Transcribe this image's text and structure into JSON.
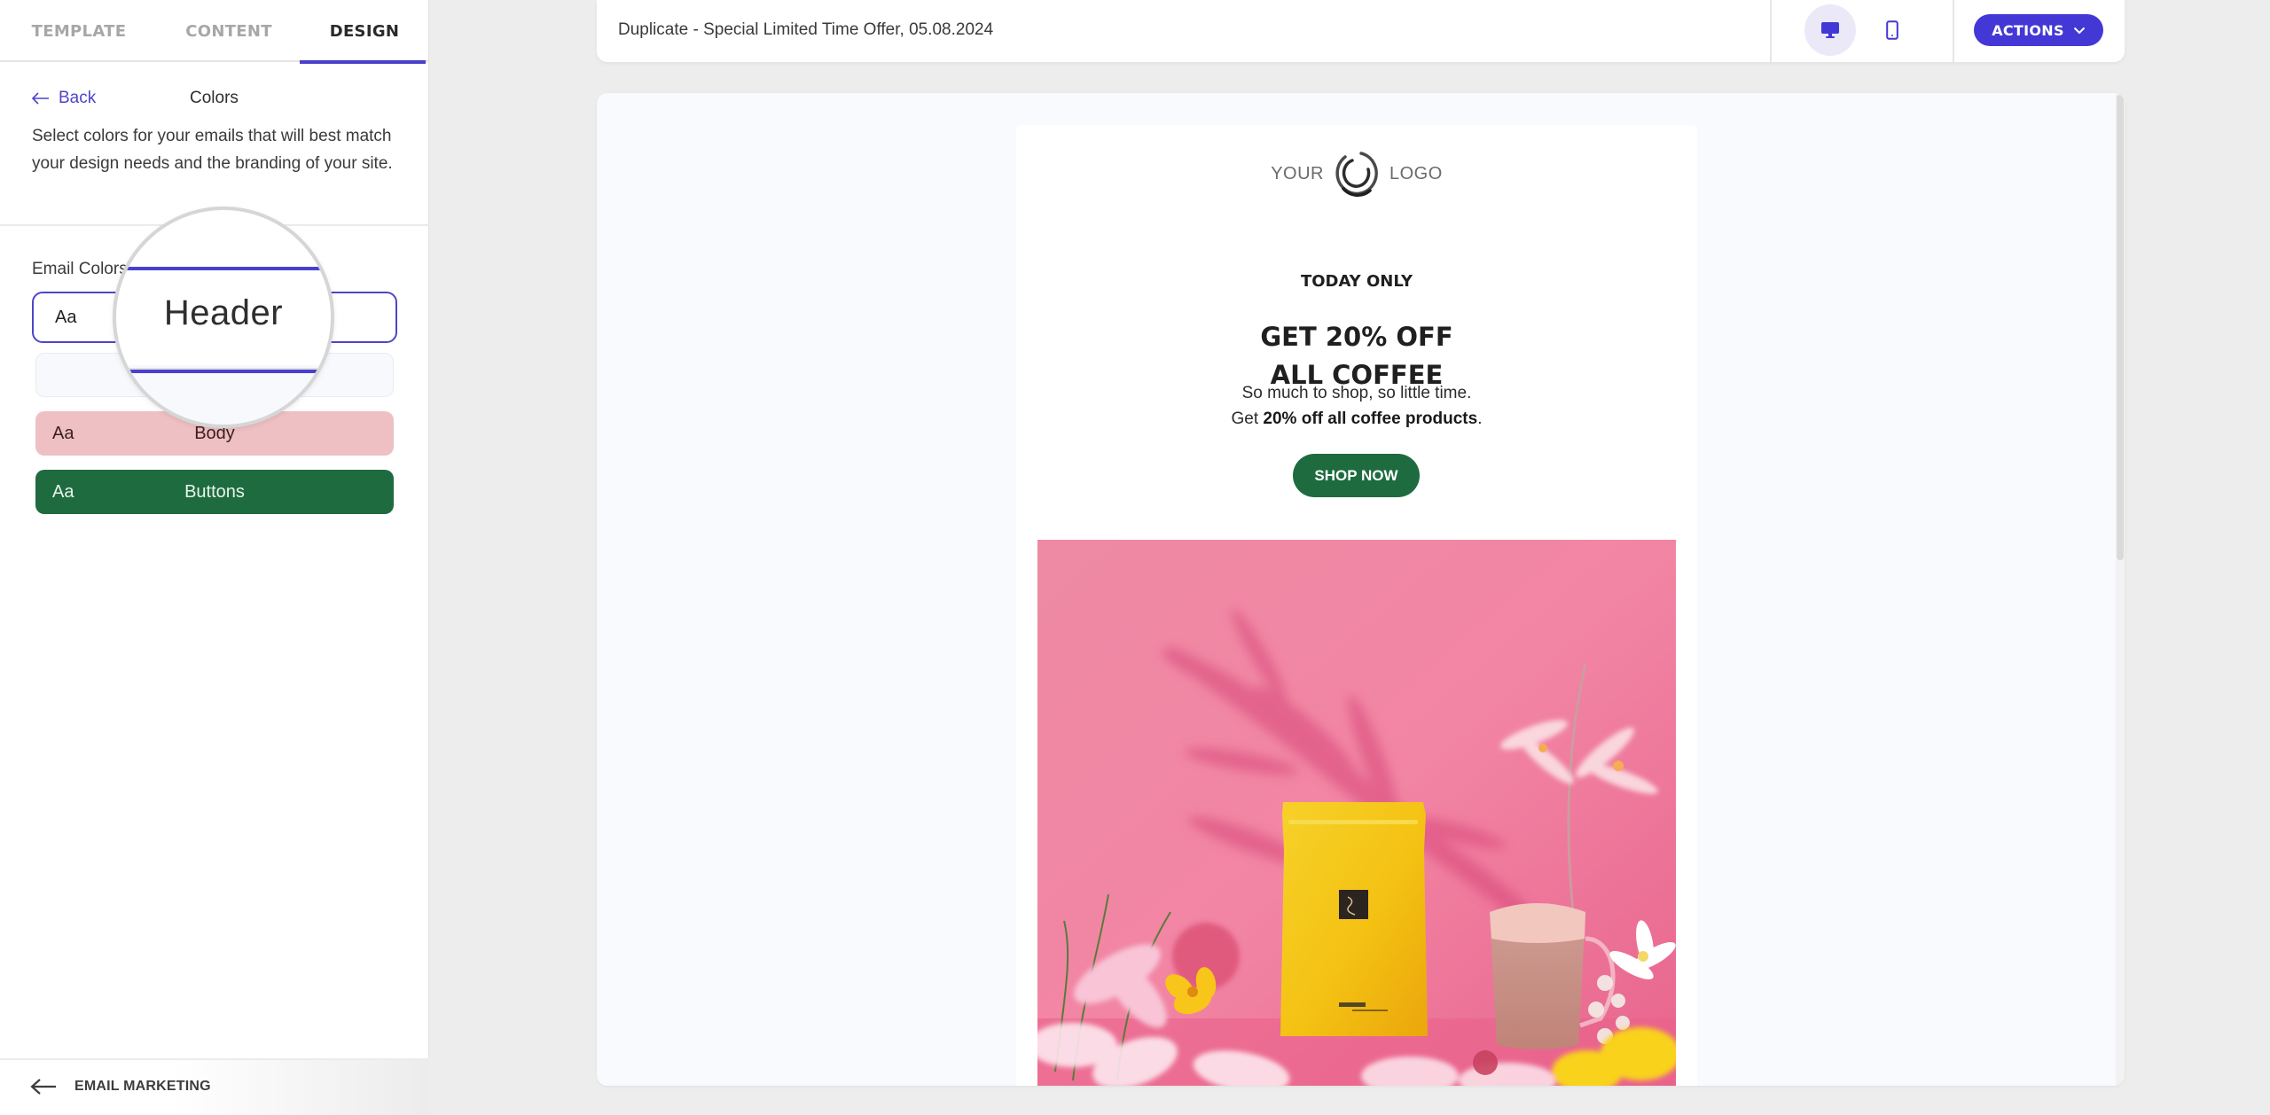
{
  "sidebar": {
    "tabs": [
      {
        "label": "TEMPLATE",
        "active": false
      },
      {
        "label": "CONTENT",
        "active": false
      },
      {
        "label": "DESIGN",
        "active": true
      }
    ],
    "back_label": "Back",
    "panel_title": "Colors",
    "description": "Select colors for your emails that will best match your design needs and the branding of your site.",
    "email_colors_label": "Email Colors",
    "color_rows": [
      {
        "sample": "Aa",
        "label": "Header",
        "bg": "#ffffff",
        "fg": "#222222",
        "selected": true
      },
      {
        "sample": "",
        "label": "",
        "bg": "#f7f9fd",
        "fg": "#555555",
        "selected": false
      },
      {
        "sample": "Aa",
        "label": "Body",
        "bg": "#eec0c3",
        "fg": "#3b1f20",
        "selected": false
      },
      {
        "sample": "Aa",
        "label": "Buttons",
        "bg": "#1e6b3f",
        "fg": "#e9f4ec",
        "selected": false
      }
    ],
    "magnifier_text": "Header",
    "footer_link": "EMAIL MARKETING"
  },
  "topbar": {
    "document_title": "Duplicate - Special Limited Time Offer, 05.08.2024",
    "devices": [
      {
        "name": "desktop",
        "icon": "desktop-icon",
        "active": true
      },
      {
        "name": "mobile",
        "icon": "mobile-icon",
        "active": false
      }
    ],
    "actions_label": "ACTIONS"
  },
  "email": {
    "logo_left": "YOUR",
    "logo_right": "LOGO",
    "eyebrow": "TODAY ONLY",
    "headline_line1": "GET 20% OFF",
    "headline_line2": "ALL COFFEE",
    "body_line1": "So much to shop, so little time.",
    "body_line2_prefix": "Get ",
    "body_line2_bold": "20% off all coffee products",
    "body_line2_suffix": ".",
    "cta_label": "SHOP NOW",
    "hero_alt": "Yellow coffee bag and latte glass on pink background with flowers"
  },
  "colors": {
    "accent": "#4a3fc8",
    "actions_button": "#4338d6",
    "cta_green": "#1d6b3f",
    "body_pink": "#eec0c3",
    "hero_pink": "#ec7b9c"
  }
}
